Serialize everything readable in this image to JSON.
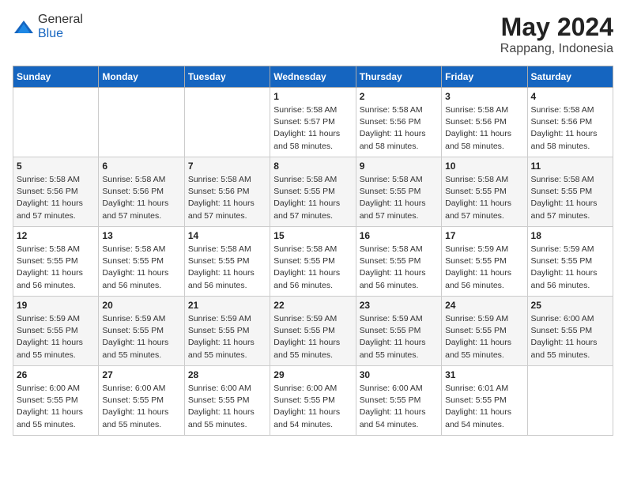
{
  "header": {
    "logo_general": "General",
    "logo_blue": "Blue",
    "month": "May 2024",
    "location": "Rappang, Indonesia"
  },
  "weekdays": [
    "Sunday",
    "Monday",
    "Tuesday",
    "Wednesday",
    "Thursday",
    "Friday",
    "Saturday"
  ],
  "weeks": [
    [
      {
        "day": "",
        "info": ""
      },
      {
        "day": "",
        "info": ""
      },
      {
        "day": "",
        "info": ""
      },
      {
        "day": "1",
        "info": "Sunrise: 5:58 AM\nSunset: 5:57 PM\nDaylight: 11 hours\nand 58 minutes."
      },
      {
        "day": "2",
        "info": "Sunrise: 5:58 AM\nSunset: 5:56 PM\nDaylight: 11 hours\nand 58 minutes."
      },
      {
        "day": "3",
        "info": "Sunrise: 5:58 AM\nSunset: 5:56 PM\nDaylight: 11 hours\nand 58 minutes."
      },
      {
        "day": "4",
        "info": "Sunrise: 5:58 AM\nSunset: 5:56 PM\nDaylight: 11 hours\nand 58 minutes."
      }
    ],
    [
      {
        "day": "5",
        "info": "Sunrise: 5:58 AM\nSunset: 5:56 PM\nDaylight: 11 hours\nand 57 minutes."
      },
      {
        "day": "6",
        "info": "Sunrise: 5:58 AM\nSunset: 5:56 PM\nDaylight: 11 hours\nand 57 minutes."
      },
      {
        "day": "7",
        "info": "Sunrise: 5:58 AM\nSunset: 5:56 PM\nDaylight: 11 hours\nand 57 minutes."
      },
      {
        "day": "8",
        "info": "Sunrise: 5:58 AM\nSunset: 5:55 PM\nDaylight: 11 hours\nand 57 minutes."
      },
      {
        "day": "9",
        "info": "Sunrise: 5:58 AM\nSunset: 5:55 PM\nDaylight: 11 hours\nand 57 minutes."
      },
      {
        "day": "10",
        "info": "Sunrise: 5:58 AM\nSunset: 5:55 PM\nDaylight: 11 hours\nand 57 minutes."
      },
      {
        "day": "11",
        "info": "Sunrise: 5:58 AM\nSunset: 5:55 PM\nDaylight: 11 hours\nand 57 minutes."
      }
    ],
    [
      {
        "day": "12",
        "info": "Sunrise: 5:58 AM\nSunset: 5:55 PM\nDaylight: 11 hours\nand 56 minutes."
      },
      {
        "day": "13",
        "info": "Sunrise: 5:58 AM\nSunset: 5:55 PM\nDaylight: 11 hours\nand 56 minutes."
      },
      {
        "day": "14",
        "info": "Sunrise: 5:58 AM\nSunset: 5:55 PM\nDaylight: 11 hours\nand 56 minutes."
      },
      {
        "day": "15",
        "info": "Sunrise: 5:58 AM\nSunset: 5:55 PM\nDaylight: 11 hours\nand 56 minutes."
      },
      {
        "day": "16",
        "info": "Sunrise: 5:58 AM\nSunset: 5:55 PM\nDaylight: 11 hours\nand 56 minutes."
      },
      {
        "day": "17",
        "info": "Sunrise: 5:59 AM\nSunset: 5:55 PM\nDaylight: 11 hours\nand 56 minutes."
      },
      {
        "day": "18",
        "info": "Sunrise: 5:59 AM\nSunset: 5:55 PM\nDaylight: 11 hours\nand 56 minutes."
      }
    ],
    [
      {
        "day": "19",
        "info": "Sunrise: 5:59 AM\nSunset: 5:55 PM\nDaylight: 11 hours\nand 55 minutes."
      },
      {
        "day": "20",
        "info": "Sunrise: 5:59 AM\nSunset: 5:55 PM\nDaylight: 11 hours\nand 55 minutes."
      },
      {
        "day": "21",
        "info": "Sunrise: 5:59 AM\nSunset: 5:55 PM\nDaylight: 11 hours\nand 55 minutes."
      },
      {
        "day": "22",
        "info": "Sunrise: 5:59 AM\nSunset: 5:55 PM\nDaylight: 11 hours\nand 55 minutes."
      },
      {
        "day": "23",
        "info": "Sunrise: 5:59 AM\nSunset: 5:55 PM\nDaylight: 11 hours\nand 55 minutes."
      },
      {
        "day": "24",
        "info": "Sunrise: 5:59 AM\nSunset: 5:55 PM\nDaylight: 11 hours\nand 55 minutes."
      },
      {
        "day": "25",
        "info": "Sunrise: 6:00 AM\nSunset: 5:55 PM\nDaylight: 11 hours\nand 55 minutes."
      }
    ],
    [
      {
        "day": "26",
        "info": "Sunrise: 6:00 AM\nSunset: 5:55 PM\nDaylight: 11 hours\nand 55 minutes."
      },
      {
        "day": "27",
        "info": "Sunrise: 6:00 AM\nSunset: 5:55 PM\nDaylight: 11 hours\nand 55 minutes."
      },
      {
        "day": "28",
        "info": "Sunrise: 6:00 AM\nSunset: 5:55 PM\nDaylight: 11 hours\nand 55 minutes."
      },
      {
        "day": "29",
        "info": "Sunrise: 6:00 AM\nSunset: 5:55 PM\nDaylight: 11 hours\nand 54 minutes."
      },
      {
        "day": "30",
        "info": "Sunrise: 6:00 AM\nSunset: 5:55 PM\nDaylight: 11 hours\nand 54 minutes."
      },
      {
        "day": "31",
        "info": "Sunrise: 6:01 AM\nSunset: 5:55 PM\nDaylight: 11 hours\nand 54 minutes."
      },
      {
        "day": "",
        "info": ""
      }
    ]
  ]
}
